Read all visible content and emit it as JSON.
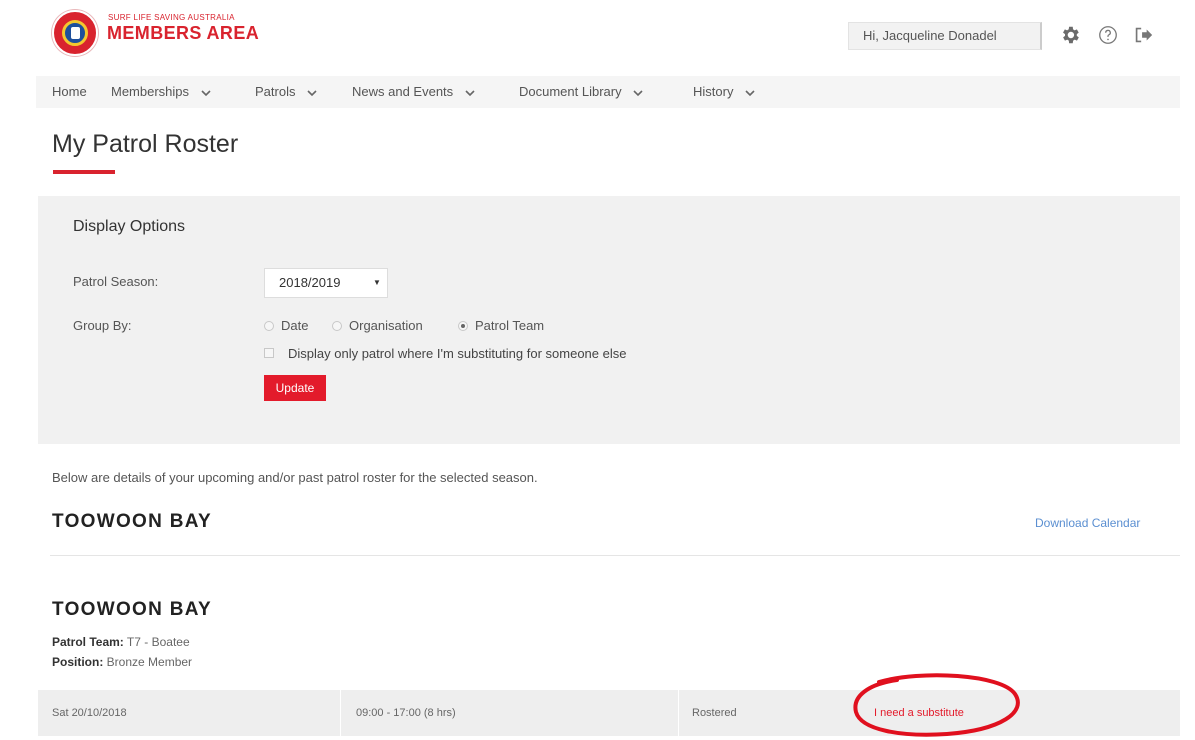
{
  "header": {
    "brand_small": "SURF LIFE SAVING AUSTRALIA",
    "brand_big": "MEMBERS AREA",
    "greeting": "Hi, Jacqueline Donadel",
    "icons": [
      "settings-gear-icon",
      "help-icon",
      "logout-icon"
    ]
  },
  "nav": {
    "items": [
      {
        "label": "Home",
        "dropdown": false
      },
      {
        "label": "Memberships",
        "dropdown": true
      },
      {
        "label": "Patrols",
        "dropdown": true
      },
      {
        "label": "News and Events",
        "dropdown": true
      },
      {
        "label": "Document Library",
        "dropdown": true
      },
      {
        "label": "History",
        "dropdown": true
      }
    ]
  },
  "page": {
    "title": "My Patrol Roster"
  },
  "display_options": {
    "heading": "Display Options",
    "season_label": "Patrol Season:",
    "season_value": "2018/2019",
    "group_by_label": "Group By:",
    "group_by_options": [
      "Date",
      "Organisation",
      "Patrol Team"
    ],
    "group_by_selected": "Patrol Team",
    "substituting_checkbox_label": "Display only patrol where I'm substituting for someone else",
    "substituting_checked": false,
    "update_label": "Update"
  },
  "intro_text": "Below are details of your upcoming and/or past patrol roster for the selected season.",
  "club": {
    "name": "TOOWOON BAY",
    "download_label": "Download Calendar"
  },
  "patrol_group": {
    "name": "TOOWOON BAY",
    "team_label": "Patrol Team:",
    "team_value": "T7 - Boatee",
    "position_label": "Position:",
    "position_value": "Bronze Member"
  },
  "roster": {
    "rows": [
      {
        "date": "Sat 20/10/2018",
        "time": "09:00 - 17:00 (8 hrs)",
        "status": "Rostered",
        "action": "I need a substitute"
      }
    ]
  },
  "colors": {
    "brand_red": "#e31b2b",
    "link_blue": "#5b8fd1",
    "panel_grey": "#f1f1f1",
    "annotation_red": "#e0101e"
  }
}
